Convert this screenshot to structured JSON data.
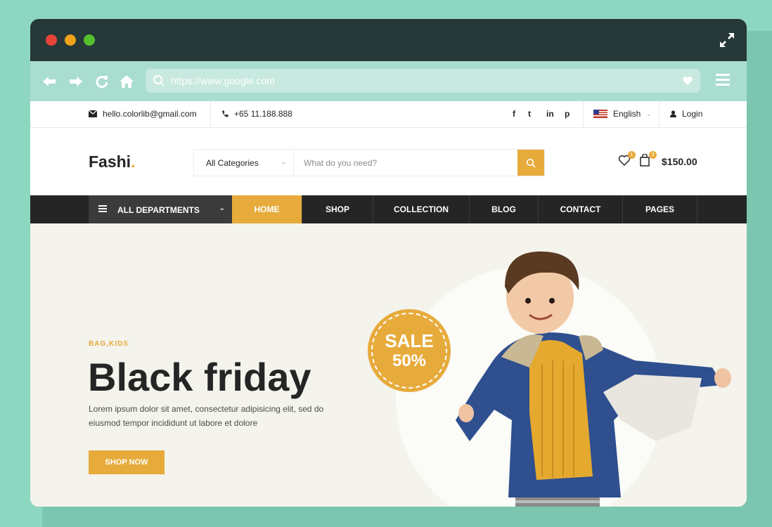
{
  "browser": {
    "url": "https://www.google.com"
  },
  "topbar": {
    "email": "hello.colorlib@gmail.com",
    "phone": "+65 11.188.888",
    "social": [
      "f",
      "t",
      "in",
      "p"
    ],
    "language": "English",
    "login": "Login"
  },
  "header": {
    "logo": "Fashi",
    "logo_dot": ".",
    "category": "All Categories",
    "search_placeholder": "What do you need?",
    "wishlist_count": "1",
    "cart_count": "3",
    "cart_total": "$150.00"
  },
  "nav": {
    "departments": "ALL DEPARTMENTS",
    "items": [
      "HOME",
      "SHOP",
      "COLLECTION",
      "BLOG",
      "CONTACT",
      "PAGES"
    ],
    "active": "HOME"
  },
  "hero": {
    "tag": "BAG,KIDS",
    "title": "Black friday",
    "description": "Lorem ipsum dolor sit amet, consectetur adipisicing elit, sed do eiusmod tempor incididunt ut labore et dolore",
    "button": "SHOP NOW",
    "sale_line1": "SALE",
    "sale_line2": "50%"
  },
  "colors": {
    "accent": "#e7ab3c",
    "dark": "#252525",
    "chrome_bar": "#263838",
    "toolbar": "#a9ddd0",
    "background": "#8dd6c0"
  }
}
